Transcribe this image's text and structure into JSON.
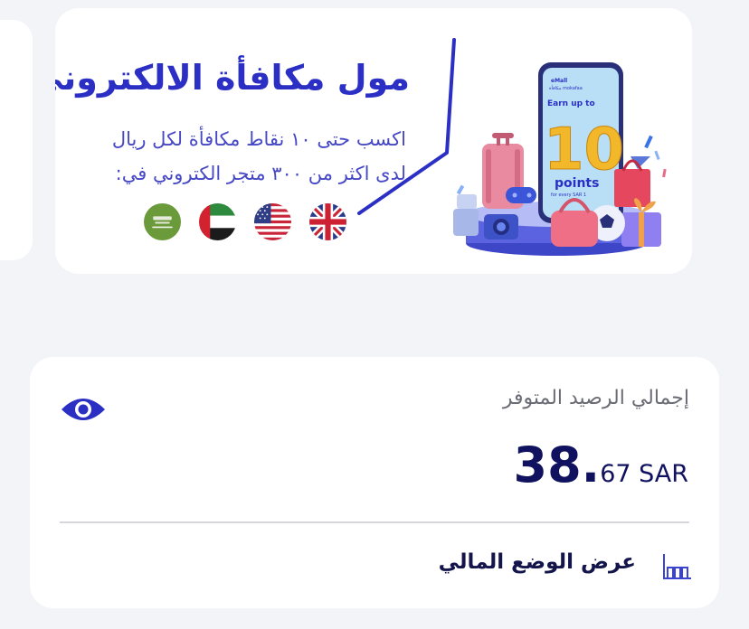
{
  "promo": {
    "title": "مول مكافأة الالكتروني",
    "desc_line1": "اكسب حتى ١٠ نقاط مكافأة لكل ريال",
    "desc_line2": "لدى اكثر من ٣٠٠ متجر الكتروني في:",
    "flags": [
      "saudi-arabia",
      "uae",
      "usa",
      "uk"
    ],
    "phone": {
      "brand": "eMall",
      "brand_sub": "مكافأة mokafaa",
      "earn": "Earn up to",
      "number": "10",
      "points": "points",
      "per": "for every SAR 1"
    }
  },
  "balance": {
    "label": "إجمالي الرصيد المتوفر",
    "amount_int": "38.",
    "amount_dec": "67 SAR",
    "report_link": "عرض الوضع المالي"
  },
  "colors": {
    "accent": "#2b2fc4",
    "navy": "#10125f",
    "background": "#f3f4f8"
  }
}
